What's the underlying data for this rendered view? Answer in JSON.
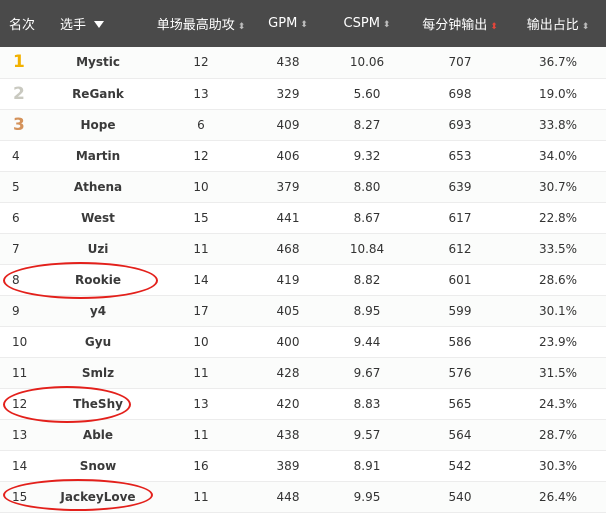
{
  "header": {
    "rank": "名次",
    "player": "选手",
    "max_assists": "单场最高助攻",
    "gpm": "GPM",
    "cspm": "CSPM",
    "dpm": "每分钟输出",
    "damage_share": "输出占比",
    "sort_icon": "⬍",
    "sort_active_color": "#e3453a"
  },
  "rows": [
    {
      "rank": "1",
      "player": "Mystic",
      "max_assists": "12",
      "gpm": "438",
      "cspm": "10.06",
      "dpm": "707",
      "share": "36.7%",
      "medal": "gold"
    },
    {
      "rank": "2",
      "player": "ReGank",
      "max_assists": "13",
      "gpm": "329",
      "cspm": "5.60",
      "dpm": "698",
      "share": "19.0%",
      "medal": "silver"
    },
    {
      "rank": "3",
      "player": "Hope",
      "max_assists": "6",
      "gpm": "409",
      "cspm": "8.27",
      "dpm": "693",
      "share": "33.8%",
      "medal": "bronze"
    },
    {
      "rank": "4",
      "player": "Martin",
      "max_assists": "12",
      "gpm": "406",
      "cspm": "9.32",
      "dpm": "653",
      "share": "34.0%"
    },
    {
      "rank": "5",
      "player": "Athena",
      "max_assists": "10",
      "gpm": "379",
      "cspm": "8.80",
      "dpm": "639",
      "share": "30.7%"
    },
    {
      "rank": "6",
      "player": "West",
      "max_assists": "15",
      "gpm": "441",
      "cspm": "8.67",
      "dpm": "617",
      "share": "22.8%"
    },
    {
      "rank": "7",
      "player": "Uzi",
      "max_assists": "11",
      "gpm": "468",
      "cspm": "10.84",
      "dpm": "612",
      "share": "33.5%"
    },
    {
      "rank": "8",
      "player": "Rookie",
      "max_assists": "14",
      "gpm": "419",
      "cspm": "8.82",
      "dpm": "601",
      "share": "28.6%",
      "circled": true
    },
    {
      "rank": "9",
      "player": "y4",
      "max_assists": "17",
      "gpm": "405",
      "cspm": "8.95",
      "dpm": "599",
      "share": "30.1%"
    },
    {
      "rank": "10",
      "player": "Gyu",
      "max_assists": "10",
      "gpm": "400",
      "cspm": "9.44",
      "dpm": "586",
      "share": "23.9%"
    },
    {
      "rank": "11",
      "player": "Smlz",
      "max_assists": "11",
      "gpm": "428",
      "cspm": "9.67",
      "dpm": "576",
      "share": "31.5%"
    },
    {
      "rank": "12",
      "player": "TheShy",
      "max_assists": "13",
      "gpm": "420",
      "cspm": "8.83",
      "dpm": "565",
      "share": "24.3%",
      "circled": true
    },
    {
      "rank": "13",
      "player": "Able",
      "max_assists": "11",
      "gpm": "438",
      "cspm": "9.57",
      "dpm": "564",
      "share": "28.7%"
    },
    {
      "rank": "14",
      "player": "Snow",
      "max_assists": "16",
      "gpm": "389",
      "cspm": "8.91",
      "dpm": "542",
      "share": "30.3%"
    },
    {
      "rank": "15",
      "player": "JackeyLove",
      "max_assists": "11",
      "gpm": "448",
      "cspm": "9.95",
      "dpm": "540",
      "share": "26.4%",
      "circled": true
    }
  ],
  "annotation_color": "#e3201b"
}
